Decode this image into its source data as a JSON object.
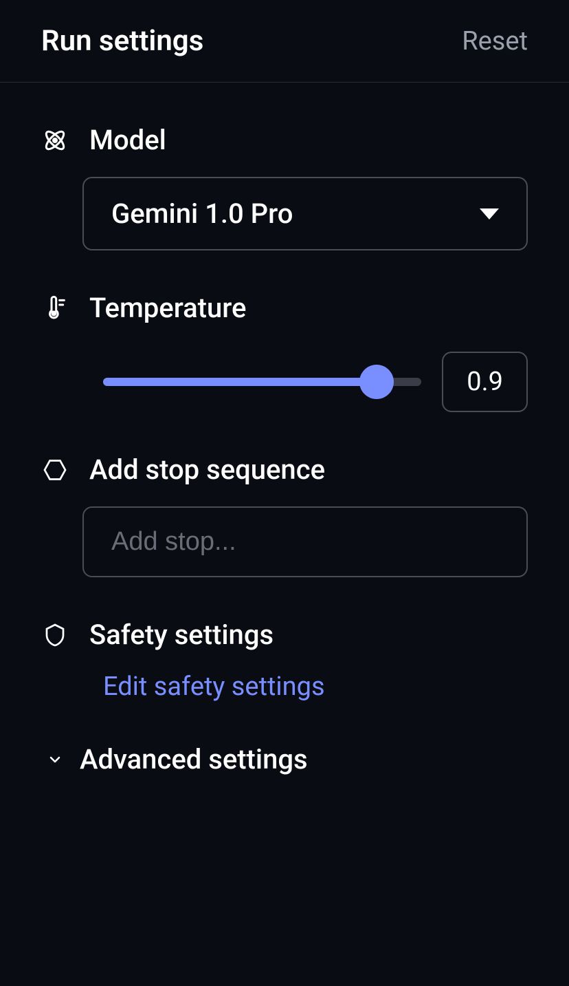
{
  "header": {
    "title": "Run settings",
    "reset_label": "Reset"
  },
  "model": {
    "label": "Model",
    "selected": "Gemini 1.0 Pro"
  },
  "temperature": {
    "label": "Temperature",
    "value": "0.9",
    "fill_percent": 86
  },
  "stop_sequence": {
    "label": "Add stop sequence",
    "placeholder": "Add stop..."
  },
  "safety": {
    "label": "Safety settings",
    "edit_link": "Edit safety settings"
  },
  "advanced": {
    "label": "Advanced settings"
  }
}
